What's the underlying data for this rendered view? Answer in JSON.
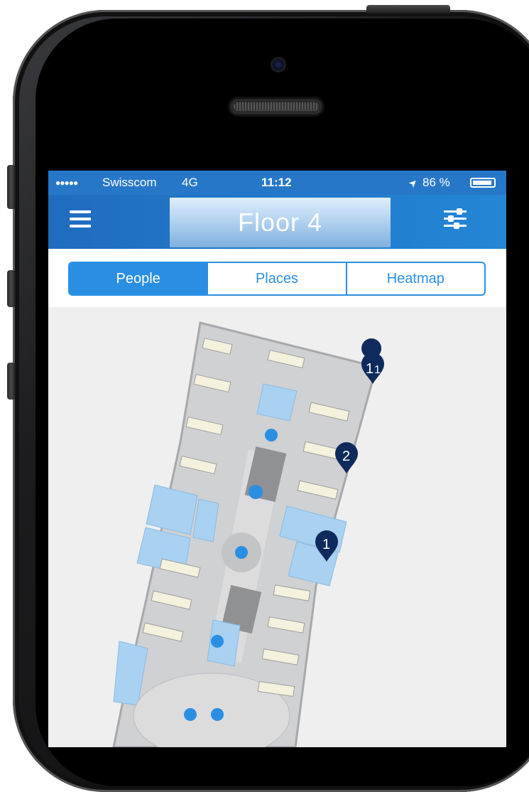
{
  "status": {
    "signal_dots": "●●●●●",
    "carrier": "Swisscom",
    "network": "4G",
    "time": "11:12",
    "location_arrow": "➤",
    "battery_percent": "86 %"
  },
  "nav": {
    "title": "Floor 4",
    "menu_icon": "hamburger-menu-icon",
    "filter_icon": "sliders-icon"
  },
  "tabs": [
    {
      "label": "People",
      "active": true
    },
    {
      "label": "Places",
      "active": false
    },
    {
      "label": "Heatmap",
      "active": false
    }
  ],
  "map": {
    "pins": [
      {
        "label": "1",
        "label2": "1"
      },
      {
        "label": "2"
      },
      {
        "label": "1"
      }
    ]
  },
  "colors": {
    "primary": "#2a8fe3",
    "navbar": "#2176c8",
    "pin": "#0f2a5c",
    "room": "#a9d1f2",
    "floor": "#cfd1d3"
  }
}
